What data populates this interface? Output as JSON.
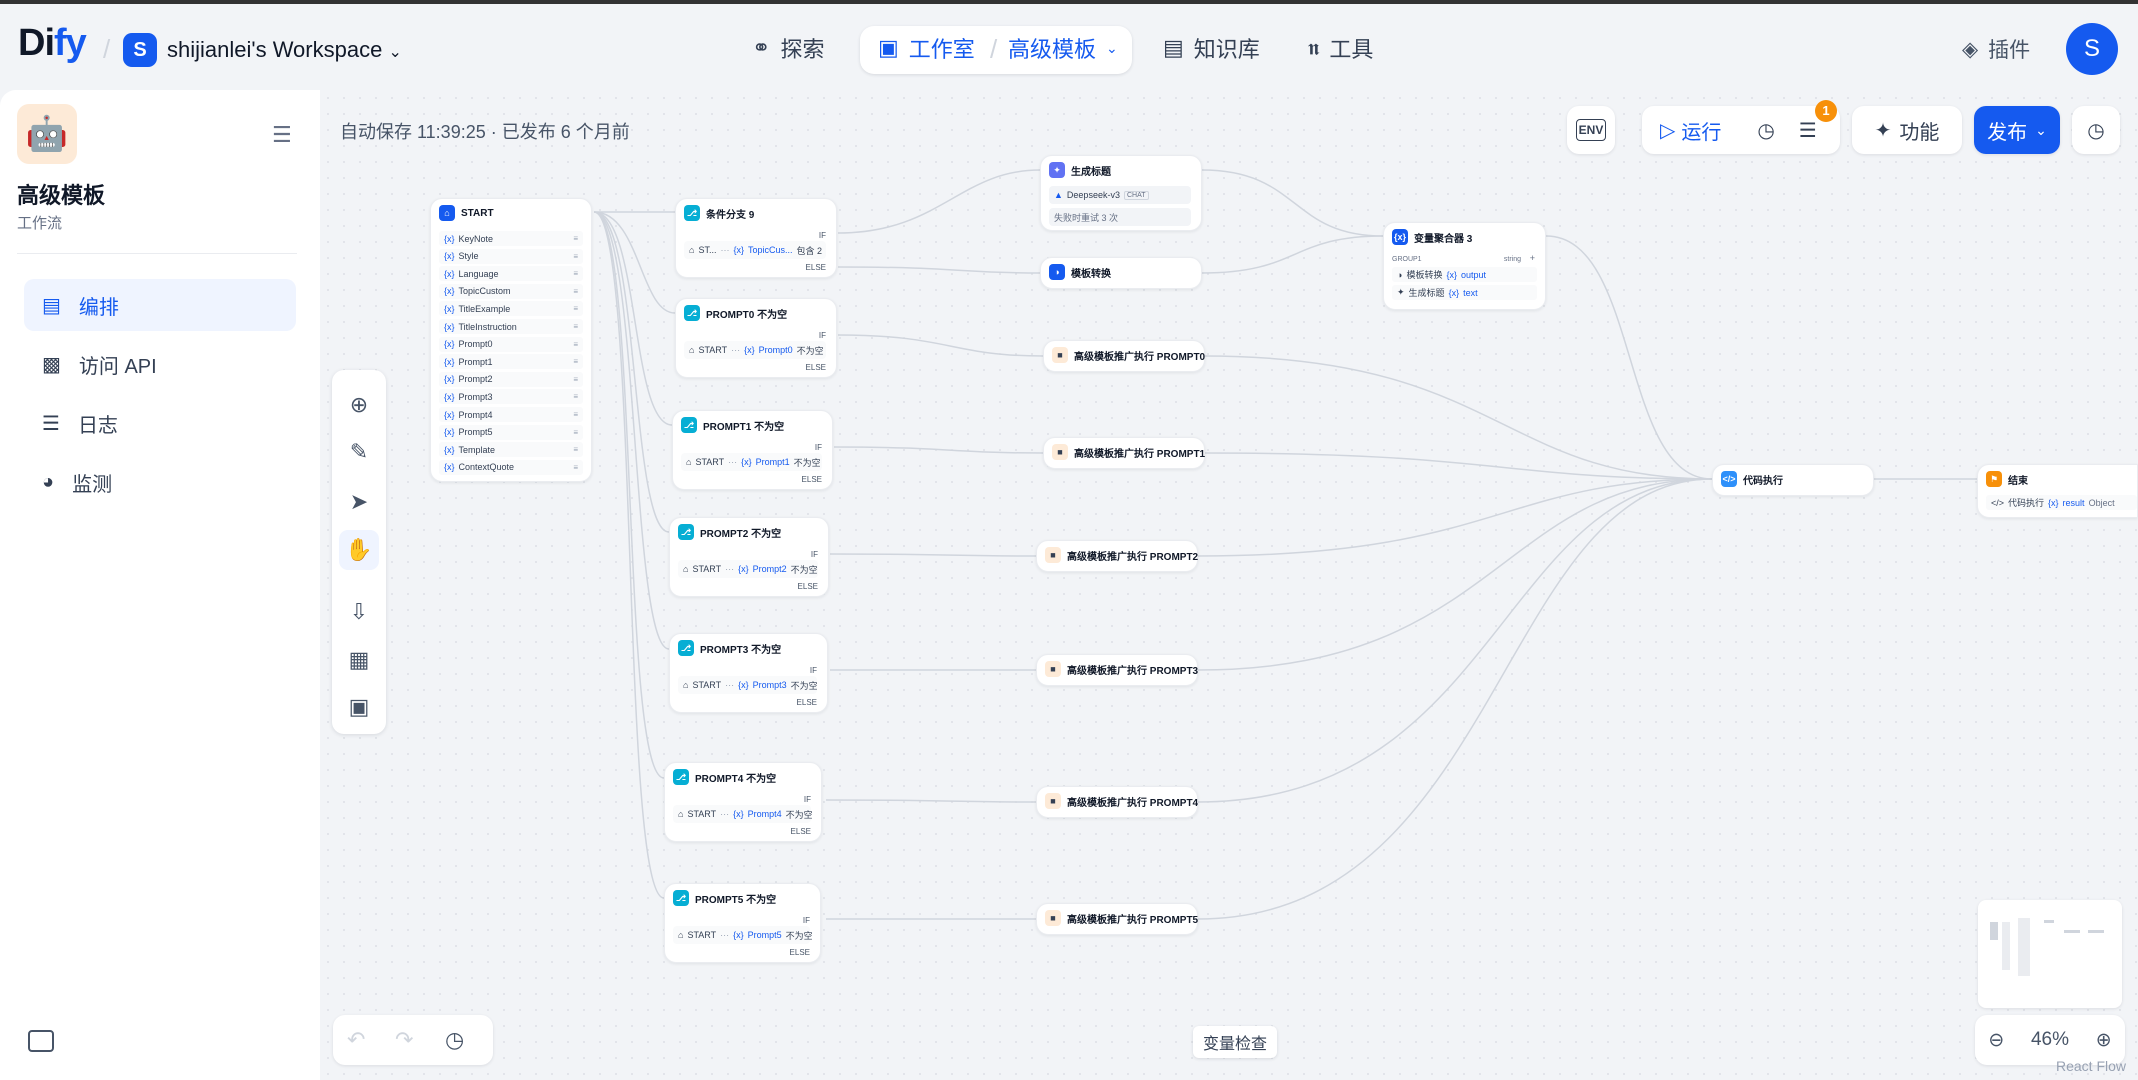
{
  "header": {
    "logo_prefix": "Di",
    "logo_accent": "fy",
    "workspace_initial": "S",
    "workspace_name": "shijianlei's Workspace",
    "nav": {
      "explore": "探索",
      "studio": "工作室",
      "app": "高级模板",
      "knowledge": "知识库",
      "tools": "工具"
    },
    "plugins": "插件",
    "user_initial": "S"
  },
  "sidebar": {
    "app_name": "高级模板",
    "app_type": "工作流",
    "menu": [
      {
        "label": "编排",
        "icon": "layout-icon",
        "active": true
      },
      {
        "label": "访问 API",
        "icon": "terminal-icon",
        "active": false
      },
      {
        "label": "日志",
        "icon": "log-icon",
        "active": false
      },
      {
        "label": "监测",
        "icon": "gauge-icon",
        "active": false
      }
    ]
  },
  "toolbar": {
    "autosave": "自动保存 11:39:25 · 已发布 6 个月前",
    "env": "ENV",
    "run": "运行",
    "checklist_count": "1",
    "features": "功能",
    "publish": "发布"
  },
  "canvas": {
    "variable_inspect": "变量检查",
    "zoom": "46%",
    "attribution": "React Flow"
  },
  "nodes": {
    "start": {
      "title": "START",
      "vars": [
        "KeyNote",
        "Style",
        "Language",
        "TopicCustom",
        "TitleExample",
        "TitleInstruction",
        "Prompt0",
        "Prompt1",
        "Prompt2",
        "Prompt3",
        "Prompt4",
        "Prompt5",
        "Template",
        "ContextQuote"
      ]
    },
    "branch9": {
      "title": "条件分支 9",
      "if": "IF",
      "else": "ELSE",
      "cond_src": "ST...",
      "cond_var": "TopicCus...",
      "cond_op": "包含 2"
    },
    "prompt_branches": [
      {
        "title": "PROMPT0 不为空",
        "var": "Prompt0"
      },
      {
        "title": "PROMPT1 不为空",
        "var": "Prompt1"
      },
      {
        "title": "PROMPT2 不为空",
        "var": "Prompt2"
      },
      {
        "title": "PROMPT3 不为空",
        "var": "Prompt3"
      },
      {
        "title": "PROMPT4 不为空",
        "var": "Prompt4"
      },
      {
        "title": "PROMPT5 不为空",
        "var": "Prompt5"
      }
    ],
    "branch_common": {
      "if": "IF",
      "else": "ELSE",
      "src": "START",
      "op": "不为空"
    },
    "gen_title": {
      "title": "生成标题",
      "model": "Deepseek-v3",
      "mode": "CHAT",
      "retry": "失败时重试 3 次"
    },
    "template_convert": {
      "title": "模板转换"
    },
    "aggregator": {
      "title": "变量聚合器 3",
      "group": "GROUP1",
      "type": "string",
      "row1_src": "模板转换",
      "row1_var": "output",
      "row2_src": "生成标题",
      "row2_var": "text"
    },
    "exec_nodes": [
      "高级模板推广执行 PROMPT0",
      "高级模板推广执行 PROMPT1",
      "高级模板推广执行 PROMPT2",
      "高级模板推广执行 PROMPT3",
      "高级模板推广执行 PROMPT4",
      "高级模板推广执行 PROMPT5"
    ],
    "code": {
      "title": "代码执行"
    },
    "end": {
      "title": "结束",
      "src": "代码执行",
      "var": "result",
      "type": "Object"
    }
  }
}
